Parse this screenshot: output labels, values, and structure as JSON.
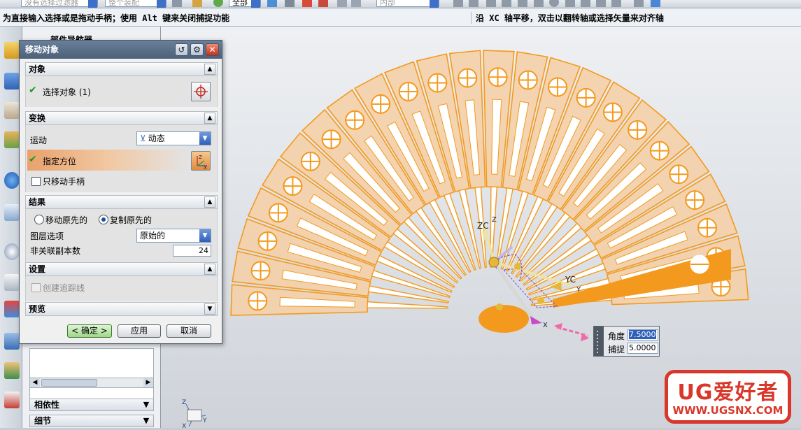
{
  "toolbar": {
    "filter_combo": "没有选择过滤器",
    "scope_combo": "整个装配",
    "layer_combo": "全部",
    "tangent_combo": "内部"
  },
  "status": {
    "left": "为直接输入选择或是拖动手柄；使用 Alt 键来关闭捕捉功能",
    "right": "沿 XC 轴平移，双击以翻转轴或选择矢量来对齐轴"
  },
  "navigator": {
    "title": "部件导航器",
    "sections": [
      "相依性",
      "细节"
    ]
  },
  "dialog": {
    "title": "移动对象",
    "object_group": {
      "title": "对象",
      "select_label": "选择对象 (1)"
    },
    "transform_group": {
      "title": "变换",
      "motion_label": "运动",
      "motion_value": "动态",
      "orient_label": "指定方位",
      "move_handle_only": "只移动手柄"
    },
    "result_group": {
      "title": "结果",
      "move_original": "移动原先的",
      "copy_original": "复制原先的",
      "layer_label": "图层选项",
      "layer_value": "原始的",
      "copies_label": "非关联副本数",
      "copies_value": "24"
    },
    "settings_group": {
      "title": "设置",
      "trace_lines": "创建追踪线"
    },
    "preview_group": {
      "title": "预览"
    },
    "buttons": {
      "ok": "< 确定 >",
      "apply": "应用",
      "cancel": "取消"
    }
  },
  "viewport": {
    "zc_label": "ZC",
    "z_label": "Z",
    "yc_label": "YC",
    "y_label": "Y",
    "x_label": "X",
    "triad_z": "Z",
    "triad_y": "Y",
    "triad_x": "X"
  },
  "angle_popup": {
    "angle_label": "角度",
    "angle_value": "7.5000",
    "snap_label": "捕捉",
    "snap_value": "5.0000"
  },
  "logo": {
    "top": "UG爱好者",
    "bottom": "WWW.UGSNX.COM"
  },
  "colors": {
    "fan_orange": "#f39a1e",
    "fan_fill": "#f6cfa4",
    "logo_red": "#d8372a",
    "selection_blue": "#2f5fb8"
  },
  "fan": {
    "segment_count": 24,
    "angle_step_deg": 7.5
  }
}
